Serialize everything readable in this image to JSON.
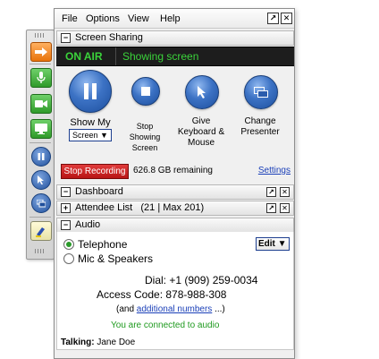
{
  "toolbar": {
    "items": [
      "arrow-right-icon",
      "microphone-icon",
      "video-camera-icon",
      "monitor-icon",
      "pause-icon",
      "pointer-icon",
      "change-presenter-icon",
      "highlighter-icon"
    ]
  },
  "menu": {
    "items": [
      "File",
      "Options",
      "View",
      "Help"
    ]
  },
  "screen_sharing": {
    "title": "Screen Sharing",
    "status": "ON AIR",
    "status_text": "Showing screen",
    "buttons": {
      "show_my": "Show My",
      "screen_dropdown": "Screen",
      "stop_showing": "Stop Showing Screen",
      "give_keyboard": "Give Keyboard & Mouse",
      "change_presenter": "Change Presenter"
    },
    "stop_recording": "Stop Recording",
    "remaining": "626.8 GB remaining",
    "settings": "Settings"
  },
  "dashboard": {
    "title": "Dashboard"
  },
  "attendee_list": {
    "title": "Attendee List",
    "counts": "(21 | Max 201)"
  },
  "audio": {
    "title": "Audio",
    "option_telephone": "Telephone",
    "option_mic": "Mic & Speakers",
    "edit_button": "Edit",
    "dial": "Dial: +1 (909) 259-0034",
    "access_code": "Access Code: 878-988-308",
    "and_text": "(and",
    "additional_numbers": "additional numbers",
    "ellipsis": "...)",
    "connected": "You are connected to audio",
    "talking_label": "Talking:",
    "talking_name": "Jane Doe"
  },
  "colors": {
    "onair_green": "#3bd43b",
    "record_red": "#c91c1c",
    "link_blue": "#1a3fb8",
    "button_blue": "#2b5fb0"
  }
}
